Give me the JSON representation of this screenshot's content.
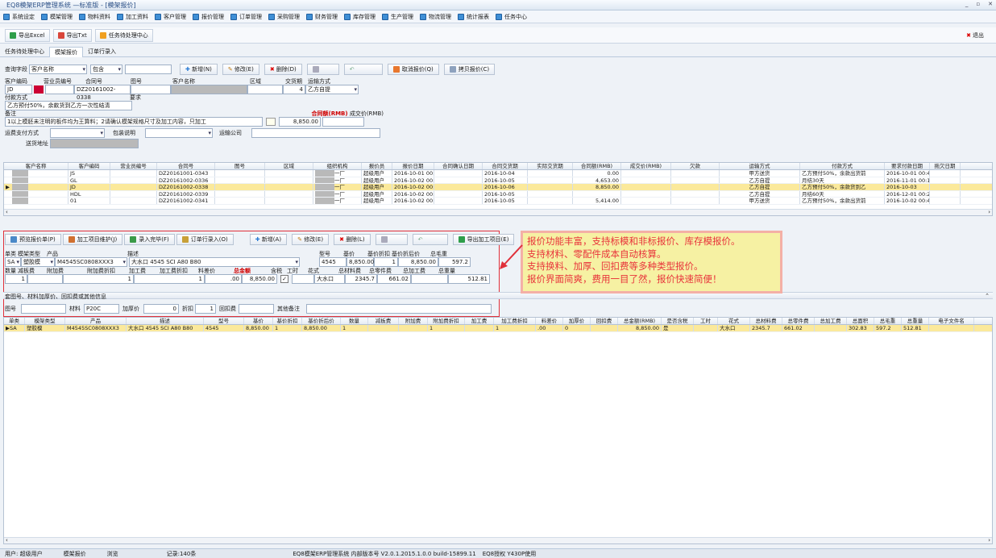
{
  "window": {
    "title": "EQ8模架ERP管理系统 —标准版 - [模架报价]",
    "controls": [
      "_",
      "▫",
      "✕"
    ]
  },
  "menu": [
    "系统设定",
    "模架管理",
    "物料资料",
    "加工资料",
    "客户管理",
    "报价管理",
    "订单管理",
    "采购管理",
    "财务管理",
    "库存管理",
    "生产管理",
    "物流管理",
    "统计报表",
    "任务中心"
  ],
  "toolbar": {
    "export_excel": "导出Excel",
    "export_txt": "导出Txt",
    "task_center": "任务待处理中心",
    "exit": "退出"
  },
  "tabs": [
    "任务待处理中心",
    "模架报价",
    "订单行录入"
  ],
  "query": {
    "label": "查询字段",
    "field": "客户名称",
    "op": "包含",
    "value": "",
    "new": "新增(N)",
    "edit": "修改(E)",
    "delete": "删除(D)",
    "undo_blank": "",
    "cancel_quote": "取消报价(Q)",
    "copy_quote": "拷贝报价(C)"
  },
  "form": {
    "labels": {
      "cust_code": "客户编码",
      "sales_code": "营业员编号",
      "contract": "合同号",
      "drawing": "图号",
      "cust_name": "客户名称",
      "region": "区域",
      "delivery_days": "交货期",
      "ship_method": "运输方式",
      "pay_method": "付款方式",
      "req": "要求",
      "remark": "备注",
      "total": "合同额(RMB)",
      "deal_price": "成交价(RMB)",
      "freight_pay": "运费支付方式",
      "pack": "包装说明",
      "ship_co": "运输公司",
      "address": "送货地址"
    },
    "cust_code": "JD",
    "contract": "DZ20161002-0338",
    "delivery_days": "4",
    "ship_method": "乙方自提",
    "pay_text": "乙方预付50%，余款货到乙方一次性结清",
    "remark_text": "1以上模胚未注明的板件均为王算料；2请确认模架规格尺寸及加工内容，只加工",
    "total_value": "8,850.00"
  },
  "upper_grid": {
    "headers": [
      "客户名称",
      "客户编码",
      "营业员编号",
      "合同号",
      "图号",
      "区域",
      "组织机构",
      "报价员",
      "报价日期",
      "合同确认日期",
      "合同交货期",
      "实际交货期",
      "合同额(RMB)",
      "成交价(RMB)",
      "欠款",
      "运输方式",
      "付款方式",
      "要求付款日期",
      "拖欠日期"
    ],
    "rows": [
      {
        "code": "JS",
        "contract": "DZ20161001-0343",
        "org": "一厂",
        "quoter": "超级用户",
        "qdate": "2016-10-01 00:45:2)",
        "due": "2016-10-04",
        "amount": "0.00",
        "deal": "",
        "ship": "甲方送货",
        "pay": "乙方预付50%，余款出货前",
        "paydate": "2016-10-01 00:45:32"
      },
      {
        "code": "GL",
        "contract": "DZ20161002-0336",
        "org": "一厂",
        "quoter": "超级用户",
        "qdate": "2016-10-02 00:16:34",
        "due": "2016-10-05",
        "amount": "4,653.00",
        "deal": "",
        "ship": "乙方自提",
        "pay": "月结30天",
        "paydate": "2016-11-01 00:16:39"
      },
      {
        "code": "JD",
        "contract": "DZ20161002-0338",
        "org": "一厂",
        "quoter": "超级用户",
        "qdate": "2016-10-02 00:20:38",
        "due": "2016-10-06",
        "amount": "8,850.00",
        "deal": "",
        "ship": "乙方自提",
        "pay": "乙方预付50%，余款货到乙",
        "paydate": "2016-10-03"
      },
      {
        "code": "HDL",
        "contract": "DZ20161002-0339",
        "org": "一厂",
        "quoter": "超级用户",
        "qdate": "2016-10-02 00:26:52",
        "due": "2016-10-05",
        "amount": "",
        "deal": "",
        "ship": "乙方自提",
        "pay": "月结60天",
        "paydate": "2016-12-01 00:26:57"
      },
      {
        "code": "01",
        "contract": "DZ20161002-0341",
        "org": "一厂",
        "quoter": "超级用户",
        "qdate": "2016-10-02 00:44:15",
        "due": "2016-10-05",
        "amount": "5,414.00",
        "deal": "",
        "ship": "甲方送货",
        "pay": "乙方预付50%，余款出货前",
        "paydate": "2016-10-02 00:44:26"
      }
    ]
  },
  "lower_toolbar": {
    "preview": "预览报价单(P)",
    "process": "加工项目维护(J)",
    "entry_done": "录入完毕(F)",
    "order_entry": "订单行录入(O)",
    "new": "新增(A)",
    "edit": "修改(E)",
    "delete": "删除(L)",
    "export": "导出加工项目(E)"
  },
  "detail": {
    "labels": {
      "unit": "单类",
      "type": "模架类型",
      "product": "产品",
      "desc": "描述",
      "model": "型号",
      "base": "基价",
      "discount": "基价折扣",
      "after": "基价折后价",
      "gross": "总毛重",
      "qty": "数量",
      "reduce": "减板费",
      "add": "附加费",
      "add_disc": "附加费折扣",
      "proc": "加工费",
      "proc_disc": "加工费折扣",
      "mat_diff": "料差价",
      "total": "总金额",
      "tax": "含税",
      "hours": "工时",
      "pattern": "花式",
      "mat_fee": "总材料费",
      "part_fee": "总零件费",
      "proc_fee": "总加工费",
      "weight": "总重量"
    },
    "unit": "SA",
    "type": "塑胶模",
    "product": "M4545SC0808XXX3",
    "desc": "大水口 4545 SCI A80 B80",
    "model": "4545",
    "base": "8,850.00",
    "discount": "1",
    "after": "8,850.00",
    "gross": "597.2",
    "qty": "1",
    "add": "1",
    "proc": "1",
    "mat_diff": ".00",
    "total": "8,850.00",
    "pattern": "大水口",
    "mat_fee": "2345.7",
    "part_fee": "661.02",
    "weight": "512.81"
  },
  "subsection": {
    "title": "套图号、材料加厚价、回扣费或其他信息",
    "drawing": "图号",
    "material": "材料",
    "material_val": "P20C",
    "thick": "加厚价",
    "thick_val": "0",
    "disc": "折扣",
    "disc_val": "1",
    "rebate": "回扣费",
    "other": "其他备注"
  },
  "lower_grid": {
    "headers": [
      "单类",
      "模架类型",
      "产品",
      "描述",
      "型号",
      "基价",
      "基价折扣",
      "基价折后价",
      "数量",
      "减板费",
      "附加费",
      "附加费折扣",
      "加工费",
      "加工费折扣",
      "料差价",
      "加厚价",
      "回扣费",
      "总金额(RMB)",
      "是否含税",
      "工时",
      "花式",
      "总材料费",
      "总零件费",
      "总加工费",
      "总面积",
      "总毛重",
      "总重量",
      "电子文件名"
    ],
    "row": [
      "SA",
      "塑胶模",
      "M4545SC0808XXX3",
      "大水口 4545 SCI A80 B80",
      "4545",
      "8,850.00",
      "1",
      "8,850.00",
      "1",
      "",
      "",
      "1",
      "",
      "1",
      ".00",
      "0",
      "",
      "8,850.00",
      "是",
      "",
      "大水口",
      "2345.7",
      "661.02",
      "",
      "302.83",
      "597.2",
      "512.81",
      ""
    ]
  },
  "annotation": [
    "报价功能丰富，支持标模和非标报价、库存模报价。",
    "支持材料、零配件成本自动核算。",
    "支持换料、加厚、回扣费等多种类型报价。",
    "报价界面简爽，费用一目了然，报价快速简便！"
  ],
  "status": [
    "用户: 超级用户",
    "模架报价",
    "浏览",
    "记录:140条",
    "EQ8模架ERP管理系统 内部版本号 V2.0.1.2015.1.0.0 build-15899.11",
    "EQ8授权 Y430P使用"
  ],
  "colors": {
    "selected_row": "#fbe99b",
    "highlight_border": "#e0303a",
    "note_bg": "#f6f1a3",
    "note_text": "#e8343b"
  }
}
